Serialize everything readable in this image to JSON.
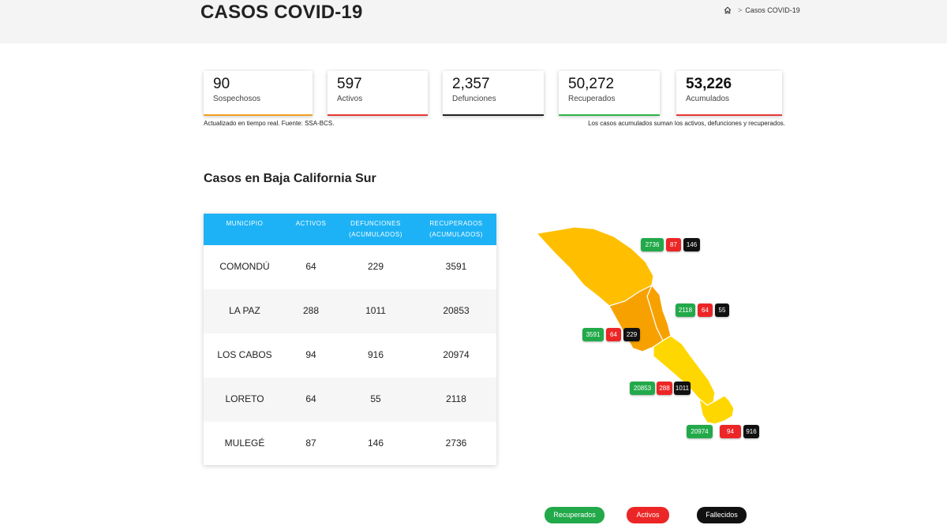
{
  "header": {
    "title": "CASOS COVID-19",
    "breadcrumb": {
      "home_icon": "home-icon",
      "separator": ">",
      "current": "Casos COVID-19"
    }
  },
  "stats": [
    {
      "value": "90",
      "label": "Sospechosos",
      "color": "#f0a020"
    },
    {
      "value": "597",
      "label": "Activos",
      "color": "#e53935"
    },
    {
      "value": "2,357",
      "label": "Defunciones",
      "color": "#222222"
    },
    {
      "value": "50,272",
      "label": "Recuperados",
      "color": "#2db34a"
    },
    {
      "value": "53,226",
      "label": "Acumulados",
      "color": "#e53935"
    }
  ],
  "notes": {
    "left": "Actualizado en tiempo real. Fuente: SSA-BCS.",
    "right": "Los casos acumulados suman los activos, defunciones y recuperados."
  },
  "section_title": "Casos en Baja California Sur",
  "table": {
    "headers": [
      "MUNICIPIO",
      "ACTIVOS",
      "DEFUNCIONES",
      "(ACUMULADOS)",
      "RECUPERADOS",
      "(ACUMULADOS)"
    ],
    "rows": [
      {
        "municipio": "COMONDÚ",
        "activos": "64",
        "defunciones": "229",
        "recuperados": "3591"
      },
      {
        "municipio": "LA PAZ",
        "activos": "288",
        "defunciones": "1011",
        "recuperados": "20853"
      },
      {
        "municipio": "LOS CABOS",
        "activos": "94",
        "defunciones": "916",
        "recuperados": "20974"
      },
      {
        "municipio": "LORETO",
        "activos": "64",
        "defunciones": "55",
        "recuperados": "2118"
      },
      {
        "municipio": "MULEGÉ",
        "activos": "87",
        "defunciones": "146",
        "recuperados": "2736"
      }
    ]
  },
  "map": {
    "colors": {
      "orange_light": "#ffbf00",
      "orange_dark": "#f7a100",
      "yellow": "#ffd700",
      "border": "#ffffff"
    },
    "badges": {
      "mulege": {
        "recuperados": "2736",
        "activos": "87",
        "fallecidos": "146"
      },
      "loreto": {
        "recuperados": "2118",
        "activos": "64",
        "fallecidos": "55"
      },
      "comondu": {
        "recuperados": "3591",
        "activos": "64",
        "fallecidos": "229"
      },
      "la_paz": {
        "recuperados": "20853",
        "activos": "288",
        "fallecidos": "1011"
      },
      "los_cabos": {
        "recuperados": "20974",
        "activos": "94",
        "fallecidos": "916"
      }
    }
  },
  "legend": {
    "recuperados": "Recuperados",
    "activos": "Activos",
    "fallecidos": "Fallecidos",
    "colors": {
      "recuperados": "#22a94a",
      "activos": "#ec2626",
      "fallecidos": "#111111"
    }
  }
}
